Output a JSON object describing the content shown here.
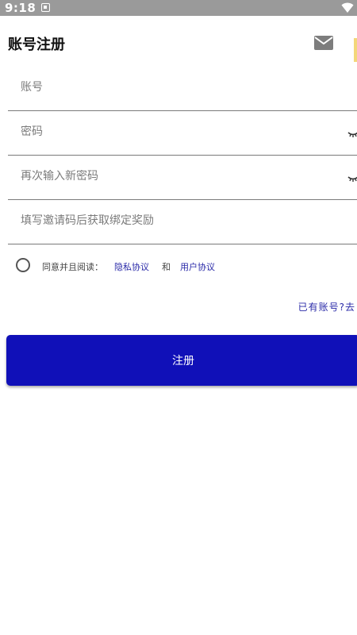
{
  "status_bar": {
    "time": "9:18",
    "notification_icon": "notification-icon",
    "wifi_icon": "wifi-icon"
  },
  "header": {
    "title": "账号注册",
    "mail_icon": "mail-icon"
  },
  "form": {
    "account": {
      "placeholder": "账号",
      "value": ""
    },
    "password": {
      "placeholder": "密码",
      "value": "",
      "toggle_icon": "eye-icon"
    },
    "confirm_password": {
      "placeholder": "再次输入新密码",
      "value": "",
      "toggle_icon": "eye-icon"
    },
    "invite_code": {
      "placeholder": "填写邀请码后获取绑定奖励",
      "value": ""
    }
  },
  "agreement": {
    "checked": false,
    "prefix": "同意并且阅读：",
    "privacy_link": "隐私协议",
    "and": "和",
    "user_link": "用户协议"
  },
  "login_link": "已有账号?去",
  "register_button": "注册",
  "colors": {
    "primary": "#1010b8",
    "link": "#2a2aa8",
    "status_bar": "#9a9a9a"
  }
}
